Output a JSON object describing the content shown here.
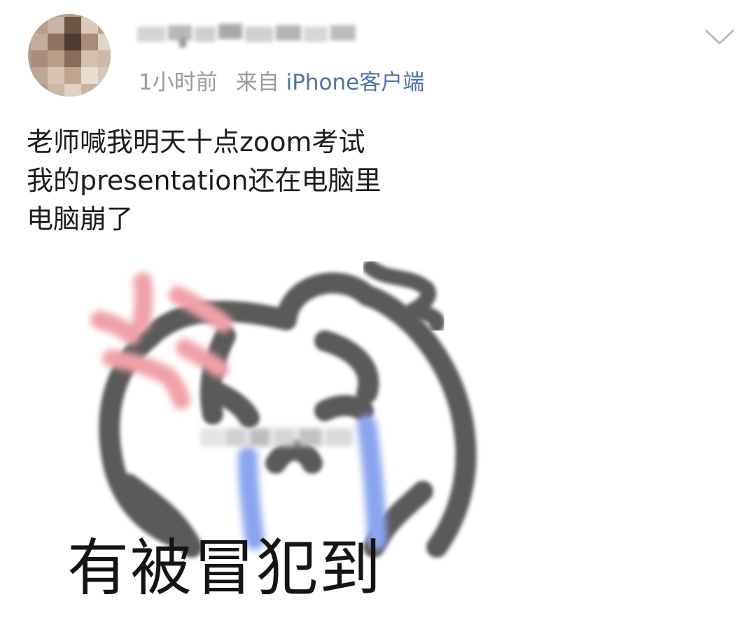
{
  "post": {
    "timestamp": "1小时前",
    "source_prefix": "来自",
    "source_client": "iPhone客户端",
    "text_lines": [
      "老师喊我明天十点zoom考试",
      "我的presentation还在电脑里",
      "电脑崩了"
    ],
    "meme_caption": "有被冒犯到"
  },
  "icons": {
    "menu": "chevron-down-icon"
  },
  "colors": {
    "meta_text": "#9a9a9a",
    "client_link": "#4e74a2",
    "body_text": "#1c1c1c",
    "meme_outline": "#5a5a5a",
    "meme_blush": "#f0a0a8",
    "meme_tears": "#8aa4f0"
  }
}
